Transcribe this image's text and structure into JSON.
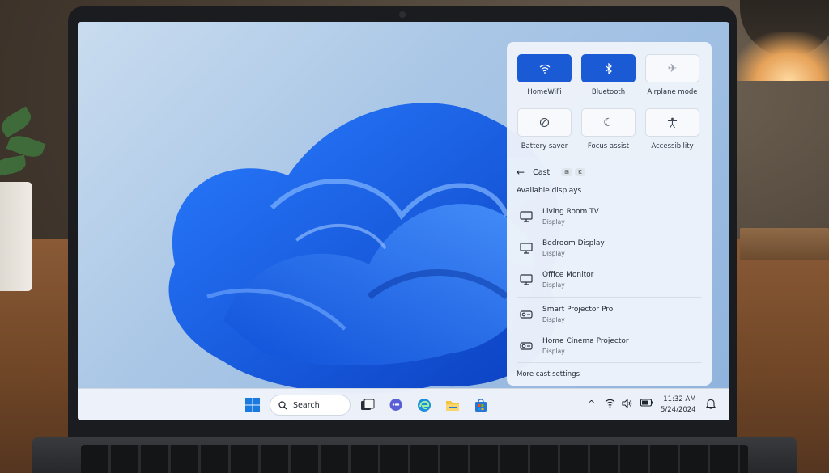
{
  "quick_settings": {
    "tiles": [
      {
        "label": "HomeWiFi",
        "icon": "wifi-icon",
        "active": true
      },
      {
        "label": "Bluetooth",
        "icon": "bluetooth-icon",
        "active": true
      },
      {
        "label": "Airplane mode",
        "icon": "airplane-icon",
        "active": false
      },
      {
        "label": "Battery saver",
        "icon": "battery-saver-icon",
        "active": false
      },
      {
        "label": "Focus assist",
        "icon": "moon-icon",
        "active": false
      },
      {
        "label": "Accessibility",
        "icon": "accessibility-icon",
        "active": false
      }
    ]
  },
  "cast": {
    "title": "Cast",
    "shortcut_keys": [
      "⊞",
      "K"
    ],
    "section_label": "Available displays",
    "devices": [
      {
        "name": "Living Room TV",
        "type": "Display",
        "icon": "monitor-icon"
      },
      {
        "name": "Bedroom Display",
        "type": "Display",
        "icon": "monitor-icon"
      },
      {
        "name": "Office Monitor",
        "type": "Display",
        "icon": "monitor-icon"
      },
      {
        "name": "Smart Projector Pro",
        "type": "Display",
        "icon": "projector-icon"
      },
      {
        "name": "Home Cinema Projector",
        "type": "Display",
        "icon": "projector-icon"
      }
    ],
    "more_settings": "More cast settings"
  },
  "taskbar": {
    "search_label": "Search",
    "time": "11:32 AM",
    "date": "5/24/2024"
  },
  "colors": {
    "accent": "#1a5ad4",
    "panel": "#eef3fa"
  }
}
